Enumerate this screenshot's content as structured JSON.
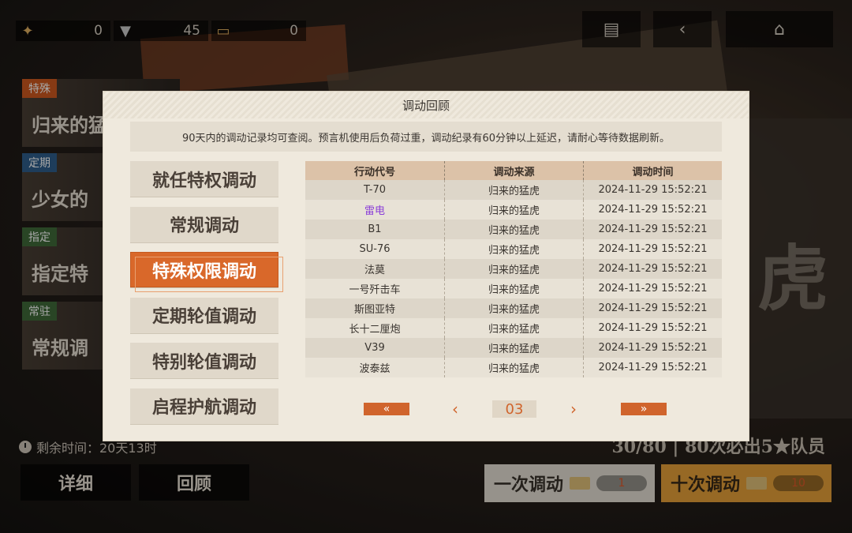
{
  "top": {
    "resources": [
      {
        "icon": "gold-eagle-icon",
        "value": "0"
      },
      {
        "icon": "triangle-badge-icon",
        "value": "45"
      },
      {
        "icon": "ticket-icon",
        "value": "0"
      }
    ],
    "buttons": [
      "notes-icon",
      "back-icon",
      "home-icon"
    ]
  },
  "background": {
    "banners": [
      {
        "tag": "特殊",
        "title": "归来的猛"
      },
      {
        "tag": "定期",
        "title": "少女的"
      },
      {
        "tag": "指定",
        "title": "指定特"
      },
      {
        "tag": "常驻",
        "title": "常规调"
      }
    ],
    "big_char": "虎",
    "remaining": "剩余时间：20天13时",
    "detail_btn": "详细",
    "review_btn": "回顾",
    "progress": "30/80 | 80次必出5★队员",
    "single_draw": {
      "label": "一次调动",
      "count": "1"
    },
    "ten_draw": {
      "label": "十次调动",
      "count": "10"
    }
  },
  "dialog": {
    "title": "调动回顾",
    "notice": "90天内的调动记录均可查阅。预言机使用后负荷过重，调动纪录有60分钟以上延迟，请耐心等待数据刷新。",
    "tabs": [
      "就任特权调动",
      "常规调动",
      "特殊权限调动",
      "定期轮值调动",
      "特别轮值调动",
      "启程护航调动"
    ],
    "active_tab": 2,
    "headers": [
      "行动代号",
      "调动来源",
      "调动时间"
    ],
    "rows": [
      {
        "code": "T-70",
        "source": "归来的猛虎",
        "time": "2024-11-29 15:52:21",
        "rare": false
      },
      {
        "code": "雷电",
        "source": "归来的猛虎",
        "time": "2024-11-29 15:52:21",
        "rare": true
      },
      {
        "code": "B1",
        "source": "归来的猛虎",
        "time": "2024-11-29 15:52:21",
        "rare": false
      },
      {
        "code": "SU-76",
        "source": "归来的猛虎",
        "time": "2024-11-29 15:52:21",
        "rare": false
      },
      {
        "code": "法莫",
        "source": "归来的猛虎",
        "time": "2024-11-29 15:52:21",
        "rare": false
      },
      {
        "code": "一号歼击车",
        "source": "归来的猛虎",
        "time": "2024-11-29 15:52:21",
        "rare": false
      },
      {
        "code": "斯图亚特",
        "source": "归来的猛虎",
        "time": "2024-11-29 15:52:21",
        "rare": false
      },
      {
        "code": "长十二厘炮",
        "source": "归来的猛虎",
        "time": "2024-11-29 15:52:21",
        "rare": false
      },
      {
        "code": "V39",
        "source": "归来的猛虎",
        "time": "2024-11-29 15:52:21",
        "rare": false
      },
      {
        "code": "波泰兹",
        "source": "归来的猛虎",
        "time": "2024-11-29 15:52:21",
        "rare": false
      }
    ],
    "pager": {
      "first": "«",
      "prev": "‹",
      "page": "03",
      "next": "›",
      "last": "»"
    }
  }
}
